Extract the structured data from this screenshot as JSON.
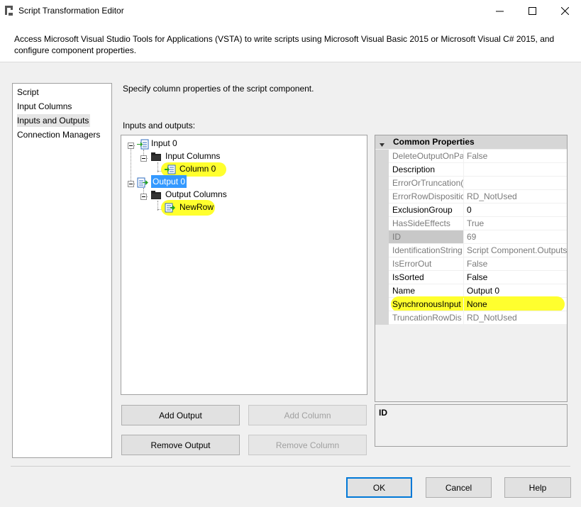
{
  "window": {
    "title": "Script Transformation Editor",
    "minimize_glyph": "—",
    "maximize_glyph": "☐",
    "close_glyph": "✕"
  },
  "header": {
    "description": "Access Microsoft Visual Studio Tools for Applications (VSTA) to write scripts using Microsoft Visual Basic 2015 or Microsoft Visual C# 2015, and configure component properties."
  },
  "nav": {
    "items": [
      {
        "label": "Script"
      },
      {
        "label": "Input Columns"
      },
      {
        "label": "Inputs and Outputs",
        "selected": true
      },
      {
        "label": "Connection Managers"
      }
    ]
  },
  "main": {
    "page_description": "Specify column properties of the script component.",
    "io_label": "Inputs and outputs:"
  },
  "tree": {
    "input": {
      "label": "Input 0",
      "icon": "input-icon"
    },
    "input_columns": {
      "label": "Input Columns",
      "icon": "folder-icon"
    },
    "column": {
      "label": "Column 0",
      "icon": "column-icon"
    },
    "output": {
      "label": "Output 0",
      "icon": "output-icon",
      "selected": true
    },
    "output_columns": {
      "label": "Output Columns",
      "icon": "folder-icon"
    },
    "new_row": {
      "label": "NewRow",
      "icon": "output-column-icon"
    }
  },
  "properties": {
    "category": "Common Properties",
    "rows": [
      {
        "name": "DeleteOutputOnPa",
        "value": "False",
        "readonly": true
      },
      {
        "name": "Description",
        "value": "",
        "readonly": false
      },
      {
        "name": "ErrorOrTruncation(",
        "value": "",
        "readonly": true
      },
      {
        "name": "ErrorRowDispositic",
        "value": "RD_NotUsed",
        "readonly": true
      },
      {
        "name": "ExclusionGroup",
        "value": "0",
        "readonly": false
      },
      {
        "name": "HasSideEffects",
        "value": "True",
        "readonly": true
      },
      {
        "name": "ID",
        "value": "69",
        "readonly": true
      },
      {
        "name": "IdentificationString",
        "value": "Script Component.Outputs",
        "readonly": true
      },
      {
        "name": "IsErrorOut",
        "value": "False",
        "readonly": true
      },
      {
        "name": "IsSorted",
        "value": "False",
        "readonly": false
      },
      {
        "name": "Name",
        "value": "Output 0",
        "readonly": false
      },
      {
        "name": "SynchronousInput",
        "value": "None",
        "readonly": false
      },
      {
        "name": "TruncationRowDis",
        "value": "RD_NotUsed",
        "readonly": true
      }
    ]
  },
  "help": {
    "title": "ID"
  },
  "buttons": {
    "add_output": "Add Output",
    "add_column": "Add Column",
    "remove_output": "Remove Output",
    "remove_column": "Remove Column",
    "ok": "OK",
    "cancel": "Cancel",
    "help": "Help"
  },
  "colors": {
    "highlight": "#ffff2e",
    "selection": "#3399ff",
    "default_button_border": "#0078d7"
  }
}
